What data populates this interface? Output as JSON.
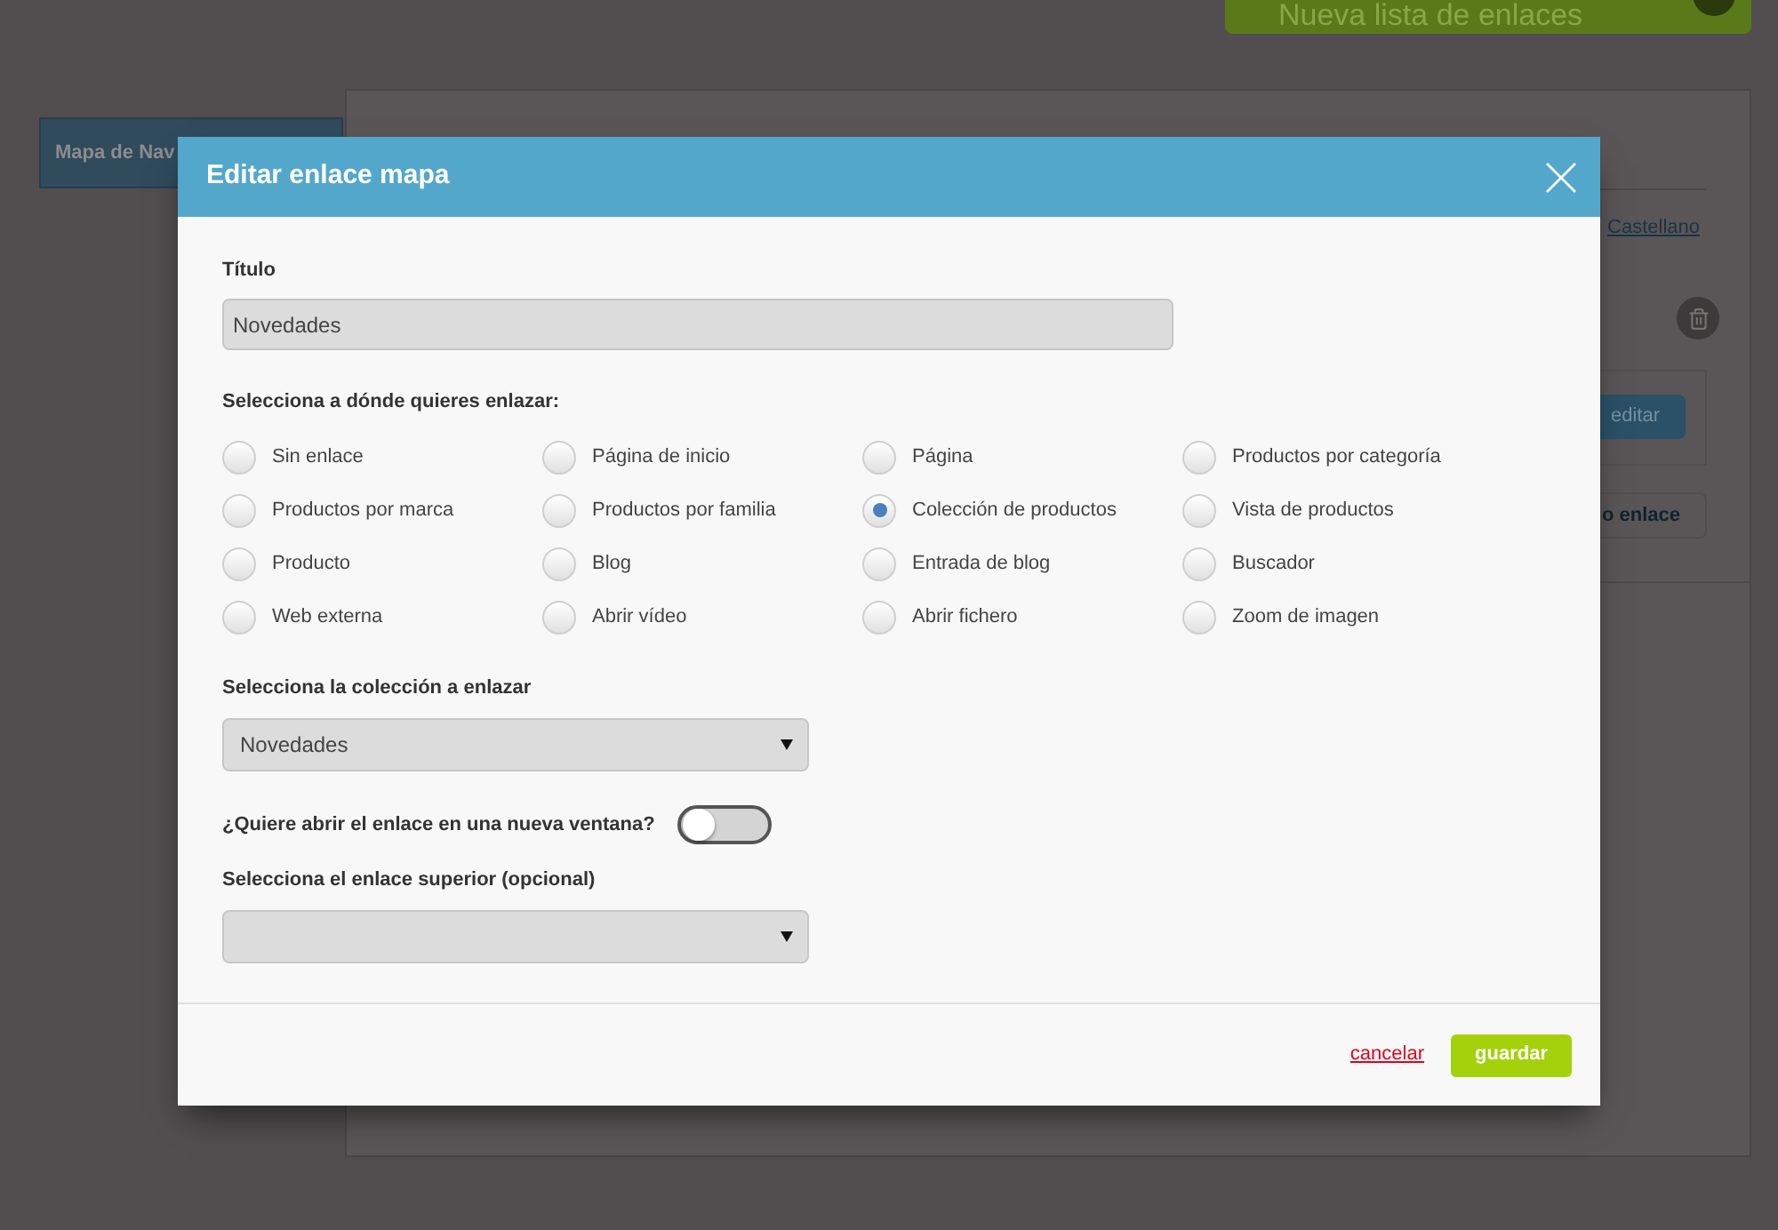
{
  "page": {
    "new_list_button": {
      "label": "Nueva lista de enlaces"
    },
    "sidebar_tab": {
      "label": "Mapa de Nav"
    },
    "language_link": {
      "label": "Castellano"
    },
    "edit_button": {
      "label": "editar"
    },
    "add_link_button": {
      "label": "o enlace"
    }
  },
  "dialog": {
    "title": "Editar enlace mapa",
    "title_field": {
      "label": "Título",
      "value": "Novedades"
    },
    "link_type": {
      "label": "Selecciona a dónde quieres enlazar:",
      "options": [
        {
          "label": "Sin enlace",
          "selected": false
        },
        {
          "label": "Página de inicio",
          "selected": false
        },
        {
          "label": "Página",
          "selected": false
        },
        {
          "label": "Productos por categoría",
          "selected": false
        },
        {
          "label": "Productos por marca",
          "selected": false
        },
        {
          "label": "Productos por familia",
          "selected": false
        },
        {
          "label": "Colección de productos",
          "selected": true
        },
        {
          "label": "Vista de productos",
          "selected": false
        },
        {
          "label": "Producto",
          "selected": false
        },
        {
          "label": "Blog",
          "selected": false
        },
        {
          "label": "Entrada de blog",
          "selected": false
        },
        {
          "label": "Buscador",
          "selected": false
        },
        {
          "label": "Web externa",
          "selected": false
        },
        {
          "label": "Abrir vídeo",
          "selected": false
        },
        {
          "label": "Abrir fichero",
          "selected": false
        },
        {
          "label": "Zoom de imagen",
          "selected": false
        }
      ]
    },
    "collection_select": {
      "label": "Selecciona la colección a enlazar",
      "value": "Novedades"
    },
    "new_window": {
      "label": "¿Quiere abrir el enlace en una nueva ventana?",
      "on": false
    },
    "parent_select": {
      "label": "Selecciona el enlace superior (opcional)"
    },
    "actions": {
      "cancel": "cancelar",
      "save": "guardar"
    }
  }
}
